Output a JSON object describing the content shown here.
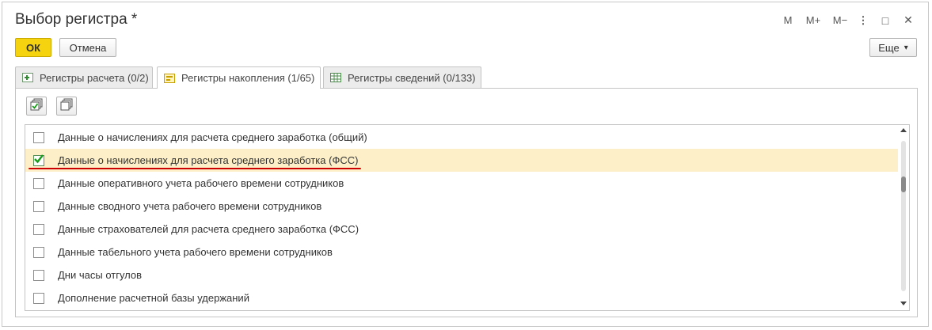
{
  "window": {
    "title": "Выбор регистра *",
    "controls": [
      "M",
      "M+",
      "M−",
      "⋮",
      "□",
      "✕"
    ]
  },
  "toolbar": {
    "ok_label": "ОК",
    "cancel_label": "Отмена",
    "more_label": "Еще",
    "more_icon": "▾"
  },
  "tabs": [
    {
      "label": "Регистры расчета (0/2)",
      "icon": "calc-register-icon",
      "active": false
    },
    {
      "label": "Регистры накопления (1/65)",
      "icon": "accumulation-register-icon",
      "active": true
    },
    {
      "label": "Регистры сведений (0/133)",
      "icon": "info-register-icon",
      "active": false
    }
  ],
  "list": {
    "rows": [
      {
        "label": "Данные о начислениях для расчета среднего заработка (общий)",
        "checked": false
      },
      {
        "label": "Данные о начислениях для расчета среднего заработка (ФСС)",
        "checked": true
      },
      {
        "label": "Данные оперативного учета рабочего времени сотрудников",
        "checked": false
      },
      {
        "label": "Данные сводного учета рабочего времени сотрудников",
        "checked": false
      },
      {
        "label": "Данные страхователей для расчета среднего заработка (ФСС)",
        "checked": false
      },
      {
        "label": "Данные табельного учета рабочего времени сотрудников",
        "checked": false
      },
      {
        "label": "Дни часы отгулов",
        "checked": false
      },
      {
        "label": "Дополнение расчетной базы удержаний",
        "checked": false
      }
    ]
  },
  "colors": {
    "ok_button": "#f5d30f",
    "selected_row": "#fdf0c8",
    "annotation_underline": "#cc0000",
    "check_mark": "#1a9a1a"
  }
}
